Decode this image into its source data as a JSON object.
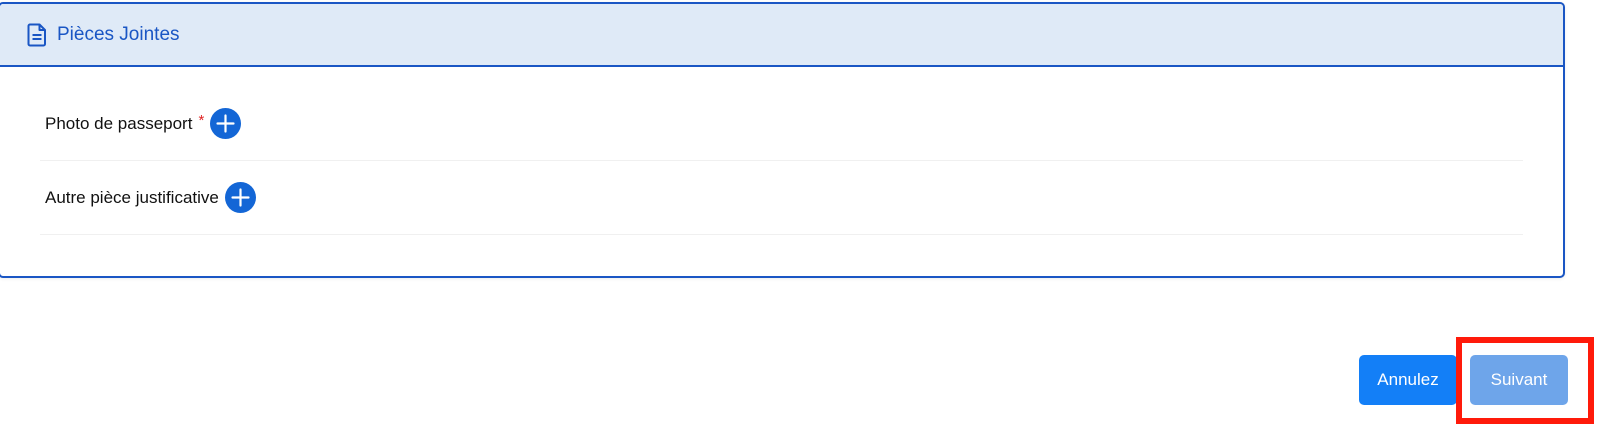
{
  "section": {
    "title": "Pièces Jointes",
    "icon": "document-icon"
  },
  "attachments": [
    {
      "label": "Photo de passeport",
      "required_mark": "*",
      "add_icon": "plus-circle-icon"
    },
    {
      "label": "Autre pièce justificative",
      "add_icon": "plus-circle-icon"
    }
  ],
  "actions": {
    "cancel_label": "Annulez",
    "next_label": "Suivant"
  },
  "colors": {
    "accent": "#1a56c4",
    "header_bg": "#dfeaf7",
    "primary_button": "#137ff7",
    "disabled_button": "#6ea5ea",
    "required": "#e02424",
    "highlight": "#ff1a0a"
  }
}
